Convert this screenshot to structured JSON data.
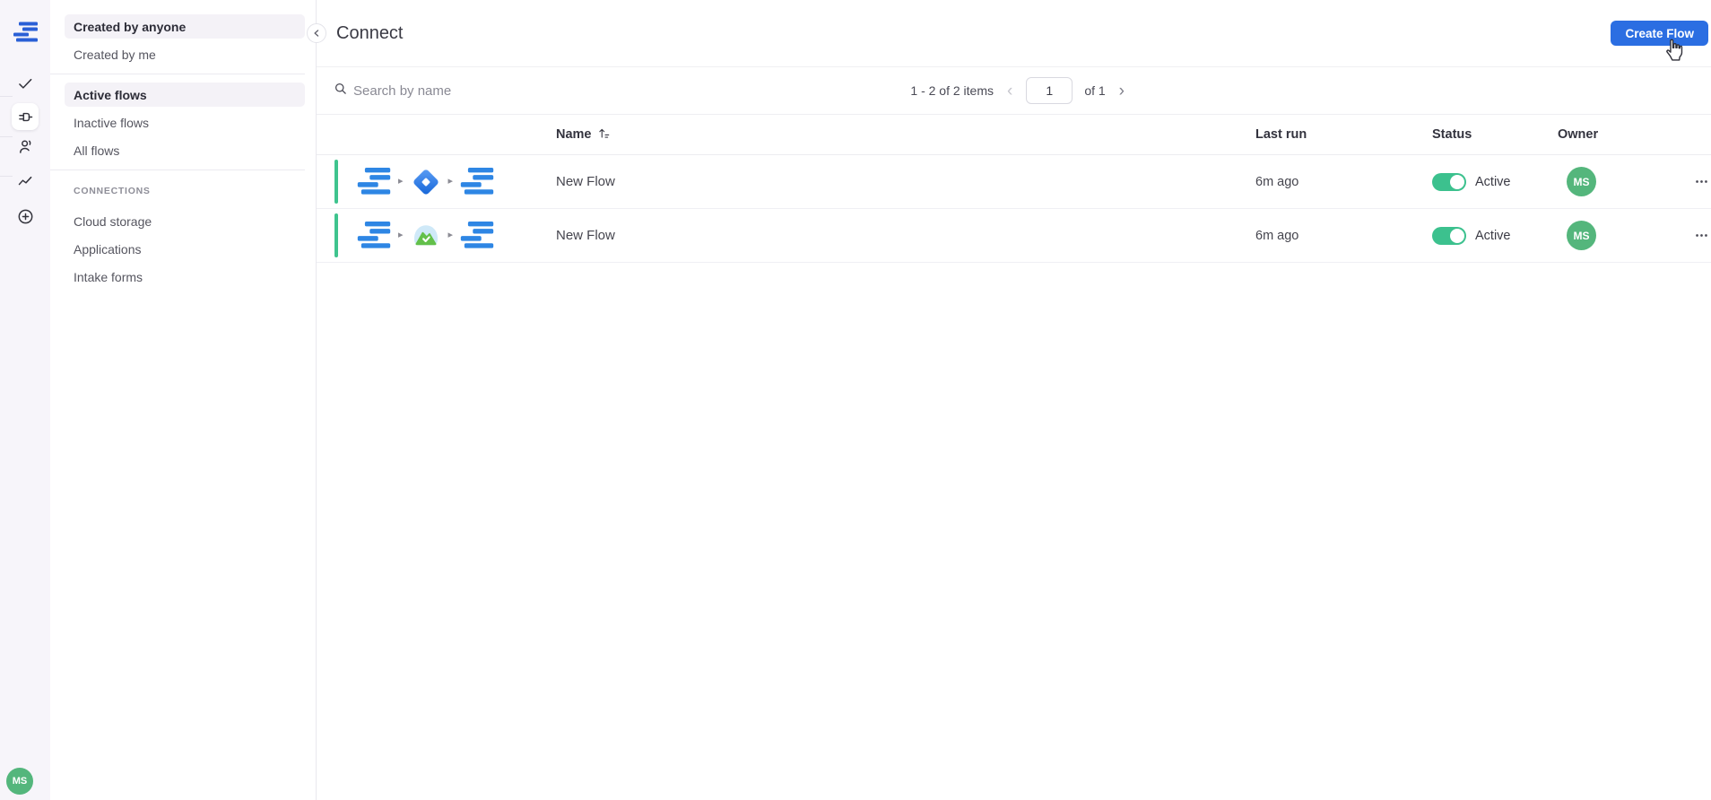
{
  "rail": {
    "logo_icon": "flatfile-logo",
    "nav_icons": [
      "check",
      "plug",
      "people",
      "activity",
      "add"
    ],
    "user_initials": "MS"
  },
  "sidebar": {
    "creator_filters": [
      {
        "label": "Created by anyone",
        "selected": true
      },
      {
        "label": "Created by me",
        "selected": false
      }
    ],
    "flow_filters": [
      {
        "label": "Active flows",
        "selected": true
      },
      {
        "label": "Inactive flows",
        "selected": false
      },
      {
        "label": "All flows",
        "selected": false
      }
    ],
    "section_label": "CONNECTIONS",
    "connection_items": [
      {
        "label": "Cloud storage"
      },
      {
        "label": "Applications"
      },
      {
        "label": "Intake forms"
      }
    ]
  },
  "header": {
    "title": "Connect",
    "create_button_label": "Create Flow"
  },
  "toolbar": {
    "search_placeholder": "Search by name",
    "pagination": {
      "summary": "1 - 2 of 2 items",
      "prev": "‹",
      "page": "1",
      "of": "of 1",
      "next": "›"
    }
  },
  "table": {
    "columns": {
      "name": "Name",
      "last_run": "Last run",
      "status": "Status",
      "owner": "Owner"
    },
    "rows": [
      {
        "name": "New Flow",
        "path": [
          "flatfile",
          "jira",
          "flatfile"
        ],
        "last_run": "6m ago",
        "status": "Active",
        "status_on": true,
        "owner_initials": "MS"
      },
      {
        "name": "New Flow",
        "path": [
          "flatfile",
          "basecamp",
          "flatfile"
        ],
        "last_run": "6m ago",
        "status": "Active",
        "status_on": true,
        "owner_initials": "MS"
      }
    ]
  },
  "colors": {
    "primary_blue": "#2b6ee2",
    "flatfile_blue": "#2e86e4",
    "toggle_green": "#3cc18e",
    "avatar_green": "#54b67c",
    "accent_bar_green": "#3fc48e",
    "rail_background": "#f7f5fa"
  }
}
